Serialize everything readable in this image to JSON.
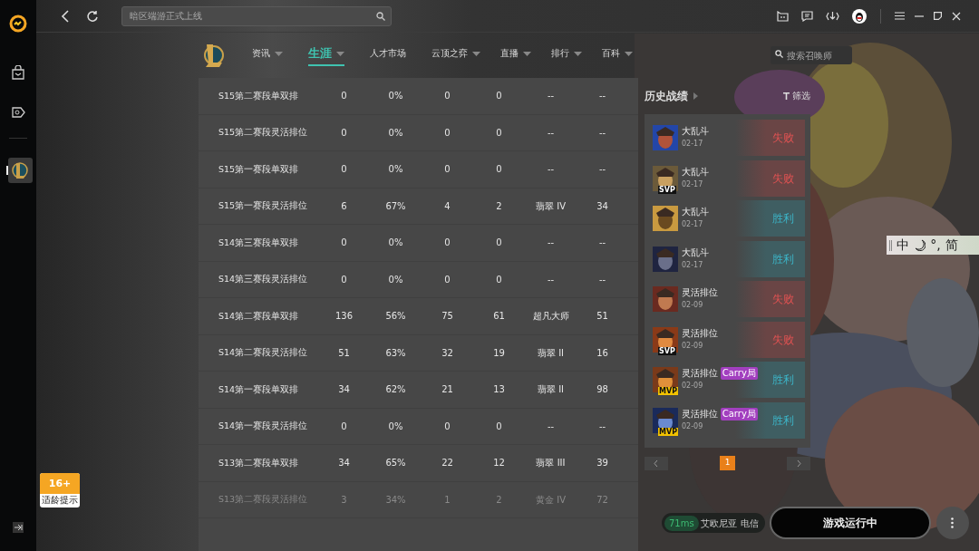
{
  "search": {
    "placeholder": "暗区端游正式上线"
  },
  "nav": [
    {
      "label": "资讯",
      "dropdown": true,
      "selected": false
    },
    {
      "label": "生涯",
      "dropdown": true,
      "selected": true
    },
    {
      "label": "人才市场",
      "dropdown": false,
      "selected": false
    },
    {
      "label": "云顶之弈",
      "dropdown": true,
      "selected": false
    },
    {
      "label": "直播",
      "dropdown": true,
      "selected": false
    },
    {
      "label": "排行",
      "dropdown": true,
      "selected": false
    },
    {
      "label": "百科",
      "dropdown": true,
      "selected": false
    }
  ],
  "summoner_search": {
    "placeholder": "搜索召唤师"
  },
  "table": {
    "rows": [
      {
        "cells": [
          "S15第二赛段单双排",
          "0",
          "0%",
          "0",
          "0",
          "--",
          "--"
        ],
        "dimmed": false
      },
      {
        "cells": [
          "S15第二赛段灵活排位",
          "0",
          "0%",
          "0",
          "0",
          "--",
          "--"
        ],
        "dimmed": false
      },
      {
        "cells": [
          "S15第一赛段单双排",
          "0",
          "0%",
          "0",
          "0",
          "--",
          "--"
        ],
        "dimmed": false
      },
      {
        "cells": [
          "S15第一赛段灵活排位",
          "6",
          "67%",
          "4",
          "2",
          "翡翠 IV",
          "34"
        ],
        "dimmed": false
      },
      {
        "cells": [
          "S14第三赛段单双排",
          "0",
          "0%",
          "0",
          "0",
          "--",
          "--"
        ],
        "dimmed": false
      },
      {
        "cells": [
          "S14第三赛段灵活排位",
          "0",
          "0%",
          "0",
          "0",
          "--",
          "--"
        ],
        "dimmed": false
      },
      {
        "cells": [
          "S14第二赛段单双排",
          "136",
          "56%",
          "75",
          "61",
          "超凡大师",
          "51"
        ],
        "dimmed": false
      },
      {
        "cells": [
          "S14第二赛段灵活排位",
          "51",
          "63%",
          "32",
          "19",
          "翡翠 II",
          "16"
        ],
        "dimmed": false
      },
      {
        "cells": [
          "S14第一赛段单双排",
          "34",
          "62%",
          "21",
          "13",
          "翡翠 II",
          "98"
        ],
        "dimmed": false
      },
      {
        "cells": [
          "S14第一赛段灵活排位",
          "0",
          "0%",
          "0",
          "0",
          "--",
          "--"
        ],
        "dimmed": false
      },
      {
        "cells": [
          "S13第二赛段单双排",
          "34",
          "65%",
          "22",
          "12",
          "翡翠 III",
          "39"
        ],
        "dimmed": false
      },
      {
        "cells": [
          "S13第二赛段灵活排位",
          "3",
          "34%",
          "1",
          "2",
          "黄金 IV",
          "72"
        ],
        "dimmed": true
      }
    ]
  },
  "history": {
    "title": "历史战绩",
    "filter": "筛选",
    "matches": [
      {
        "mode": "大乱斗",
        "date": "02-17",
        "result": "失败",
        "win": false
      },
      {
        "mode": "大乱斗",
        "date": "02-17",
        "result": "失败",
        "win": false,
        "badge": "SVP"
      },
      {
        "mode": "大乱斗",
        "date": "02-17",
        "result": "胜利",
        "win": true
      },
      {
        "mode": "大乱斗",
        "date": "02-17",
        "result": "胜利",
        "win": true
      },
      {
        "mode": "灵活排位",
        "date": "02-09",
        "result": "失败",
        "win": false
      },
      {
        "mode": "灵活排位",
        "date": "02-09",
        "result": "失败",
        "win": false,
        "badge": "SVP"
      },
      {
        "mode": "灵活排位",
        "date": "02-09",
        "result": "胜利",
        "win": true,
        "badge": "MVP",
        "tag": "Carry局"
      },
      {
        "mode": "灵活排位",
        "date": "02-09",
        "result": "胜利",
        "win": true,
        "badge": "MVP",
        "tag": "Carry局"
      }
    ],
    "pages": [
      {
        "label": "1",
        "selected": true
      }
    ]
  },
  "age_rating": {
    "label": "16+",
    "caption": "适龄提示"
  },
  "ime": {
    "items": [
      "中",
      "°,",
      "简"
    ]
  },
  "status": {
    "ping": "71ms",
    "server": "艾欧尼亚 电信"
  },
  "launch_button": "游戏运行中"
}
